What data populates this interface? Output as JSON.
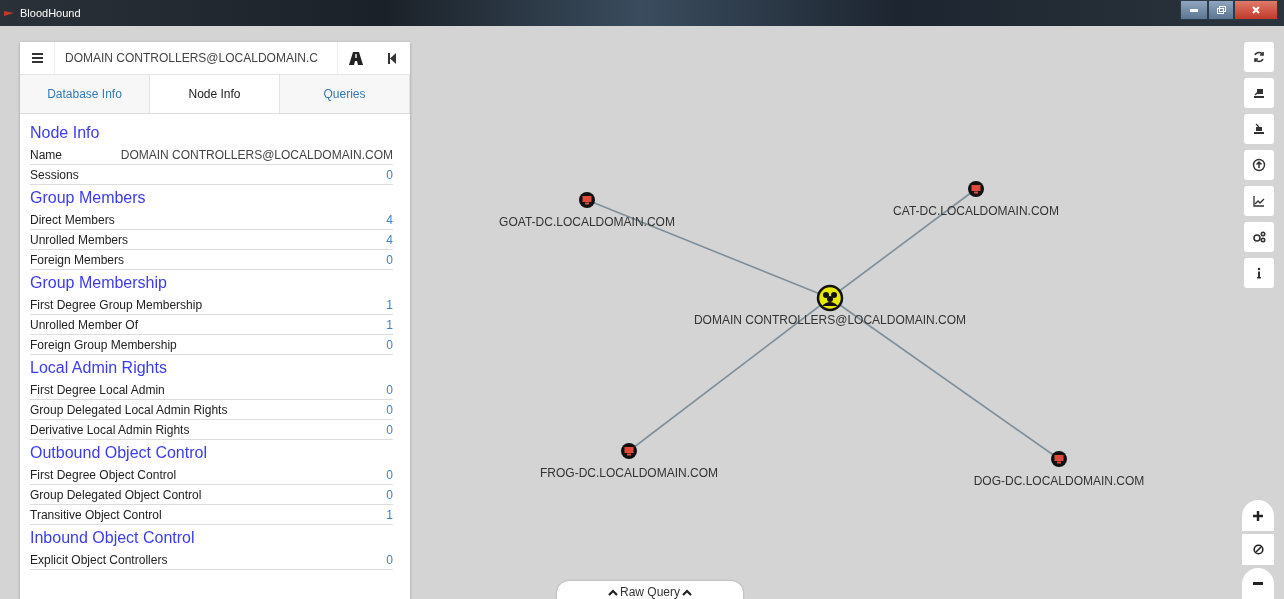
{
  "window": {
    "title": "BloodHound"
  },
  "panel": {
    "search_value": "DOMAIN CONTROLLERS@LOCALDOMAIN.C",
    "tabs": [
      {
        "label": "Database Info",
        "selected": false
      },
      {
        "label": "Node Info",
        "selected": true
      },
      {
        "label": "Queries",
        "selected": false
      }
    ],
    "sections": [
      {
        "title": "Node Info",
        "rows": [
          {
            "label": "Name",
            "value": "DOMAIN CONTROLLERS@LOCALDOMAIN.COM",
            "kind": "text"
          },
          {
            "label": "Sessions",
            "value": "0",
            "kind": "count"
          }
        ]
      },
      {
        "title": "Group Members",
        "rows": [
          {
            "label": "Direct Members",
            "value": "4",
            "kind": "count"
          },
          {
            "label": "Unrolled Members",
            "value": "4",
            "kind": "count"
          },
          {
            "label": "Foreign Members",
            "value": "0",
            "kind": "count"
          }
        ]
      },
      {
        "title": "Group Membership",
        "rows": [
          {
            "label": "First Degree Group Membership",
            "value": "1",
            "kind": "count"
          },
          {
            "label": "Unrolled Member Of",
            "value": "1",
            "kind": "count"
          },
          {
            "label": "Foreign Group Membership",
            "value": "0",
            "kind": "count"
          }
        ]
      },
      {
        "title": "Local Admin Rights",
        "rows": [
          {
            "label": "First Degree Local Admin",
            "value": "0",
            "kind": "count"
          },
          {
            "label": "Group Delegated Local Admin Rights",
            "value": "0",
            "kind": "count"
          },
          {
            "label": "Derivative Local Admin Rights",
            "value": "0",
            "kind": "count"
          }
        ]
      },
      {
        "title": "Outbound Object Control",
        "rows": [
          {
            "label": "First Degree Object Control",
            "value": "0",
            "kind": "count"
          },
          {
            "label": "Group Delegated Object Control",
            "value": "0",
            "kind": "count"
          },
          {
            "label": "Transitive Object Control",
            "value": "1",
            "kind": "count"
          }
        ]
      },
      {
        "title": "Inbound Object Control",
        "rows": [
          {
            "label": "Explicit Object Controllers",
            "value": "0",
            "kind": "count"
          }
        ]
      }
    ]
  },
  "graph": {
    "nodes": [
      {
        "label": "DOMAIN CONTROLLERS@LOCALDOMAIN.COM",
        "kind": "group"
      },
      {
        "label": "GOAT-DC.LOCALDOMAIN.COM",
        "kind": "computer"
      },
      {
        "label": "CAT-DC.LOCALDOMAIN.COM",
        "kind": "computer"
      },
      {
        "label": "FROG-DC.LOCALDOMAIN.COM",
        "kind": "computer"
      },
      {
        "label": "DOG-DC.LOCALDOMAIN.COM",
        "kind": "computer"
      }
    ]
  },
  "raw_query": {
    "label": "Raw Query"
  }
}
